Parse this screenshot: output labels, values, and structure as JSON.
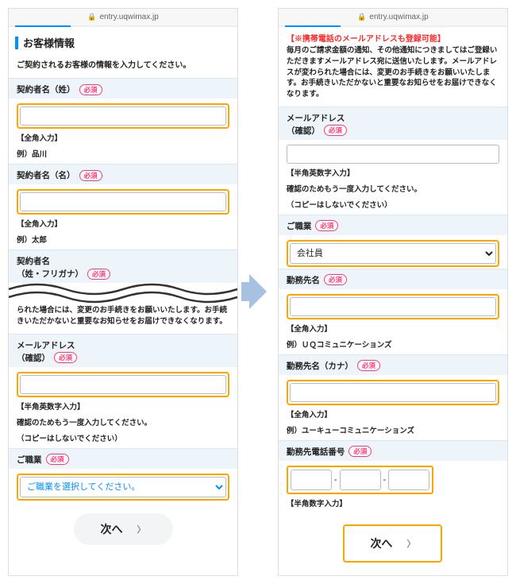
{
  "url": "entry.uqwimax.jp",
  "left": {
    "section_title": "お客様情報",
    "intro": "ご契約されるお客様の情報を入力してください。",
    "f1": {
      "label": "契約者名（姓）",
      "req": "必須",
      "hint1": "【全角入力】",
      "hint2": "例）品川"
    },
    "f2": {
      "label": "契約者名（名）",
      "req": "必須",
      "hint1": "【全角入力】",
      "hint2": "例）太郎"
    },
    "f3": {
      "label1": "契約者名",
      "label2": "（姓・フリガナ）",
      "req": "必須"
    },
    "warn": "られた場合には、変更のお手続きをお願いいたします。お手続きいただかないと重要なお知らせをお届けできなくなります。",
    "f4": {
      "label1": "メールアドレス",
      "label2": "（確認）",
      "req": "必須",
      "hint1": "【半角英数字入力】",
      "hint2": "確認のためもう一度入力してください。",
      "hint3": "（コピーはしないでください）"
    },
    "f5": {
      "label": "ご職業",
      "req": "必須",
      "placeholder": "ご職業を選択してください。"
    },
    "next": "次へ"
  },
  "right": {
    "red": "【※携帯電話のメールアドレスも登録可能】",
    "para": "毎月のご請求金額の通知、その他通知につきましてはご登録いただきますメールアドレス宛に送信いたします。メールアドレスが変わられた場合には、変更のお手続きをお願いいたします。お手続きいただかないと重要なお知らせをお届けできなくなります。",
    "f1": {
      "label1": "メールアドレス",
      "label2": "（確認）",
      "req": "必須",
      "hint1": "【半角英数字入力】",
      "hint2": "確認のためもう一度入力してください。",
      "hint3": "（コピーはしないでください）"
    },
    "f2": {
      "label": "ご職業",
      "req": "必須",
      "value": "会社員"
    },
    "f3": {
      "label": "勤務先名",
      "req": "必須",
      "hint1": "【全角入力】",
      "hint2": "例）ＵＱコミュニケーションズ"
    },
    "f4": {
      "label": "勤務先名（カナ）",
      "req": "必須",
      "hint1": "【全角入力】",
      "hint2": "例）ユーキューコミュニケーションズ"
    },
    "f5": {
      "label": "勤務先電話番号",
      "req": "必須",
      "hint1": "【半角数字入力】"
    },
    "next": "次へ"
  }
}
